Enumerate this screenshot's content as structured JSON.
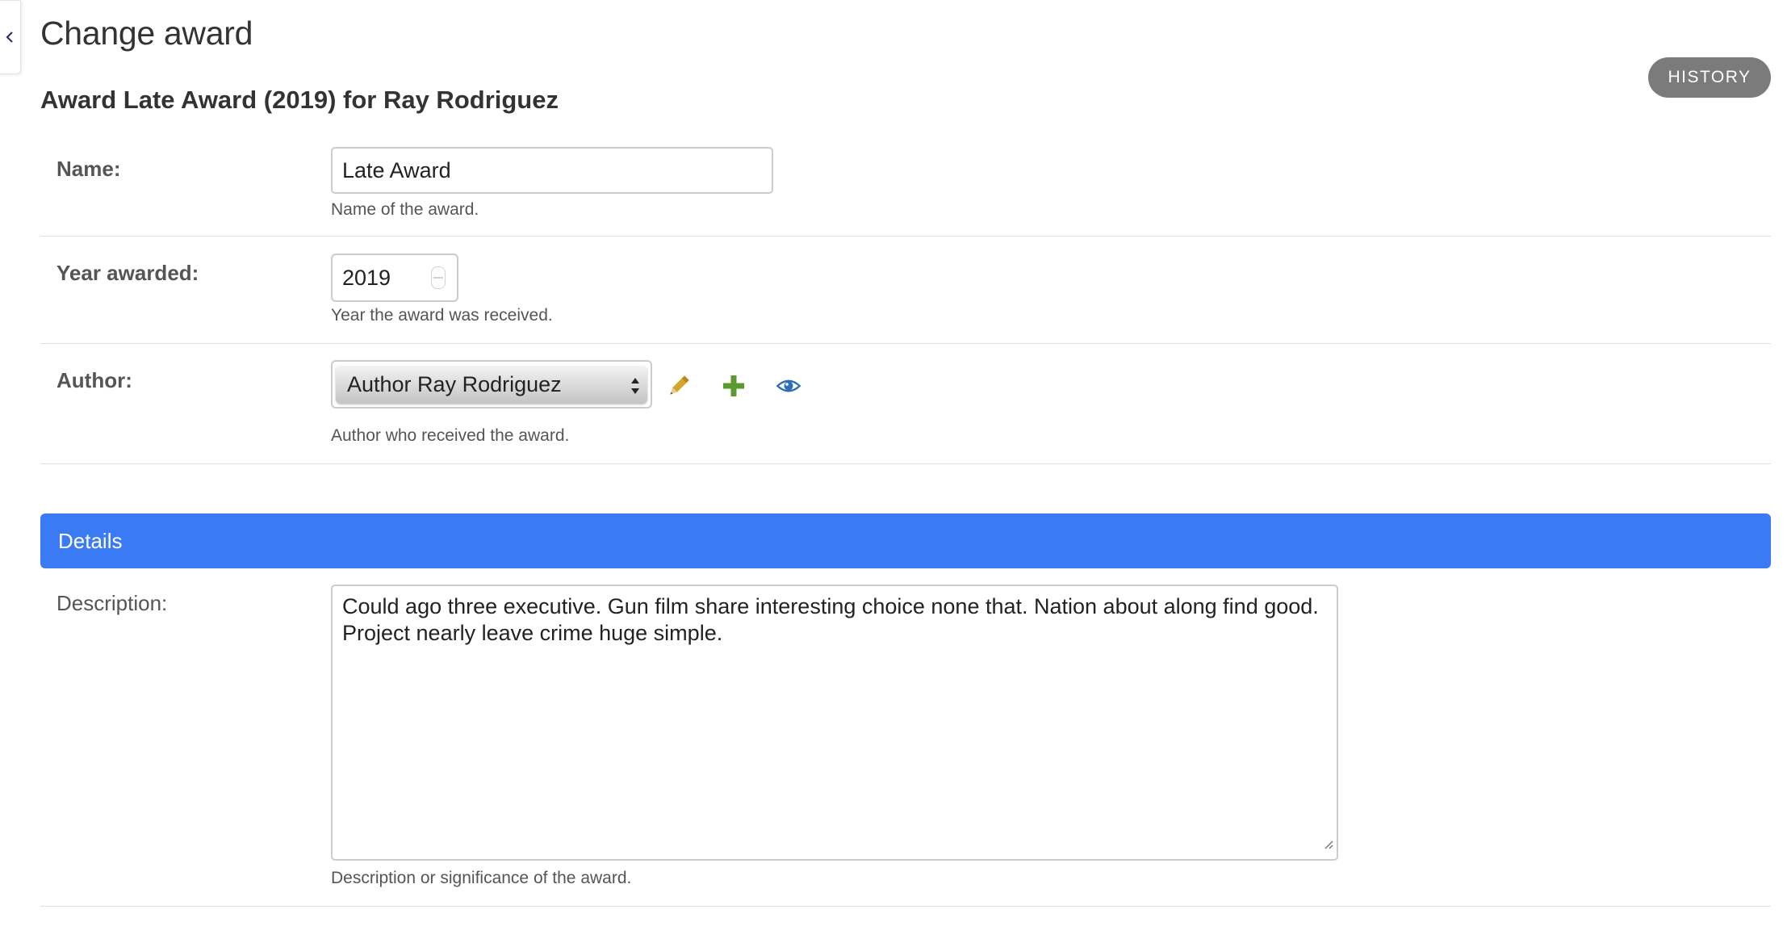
{
  "page": {
    "title": "Change award",
    "object_heading": "Award Late Award (2019) for Ray Rodriguez",
    "history_label": "HISTORY"
  },
  "fields": {
    "name": {
      "label": "Name:",
      "value": "Late Award",
      "help": "Name of the award."
    },
    "year": {
      "label": "Year awarded:",
      "value": "2019",
      "help": "Year the award was received."
    },
    "author": {
      "label": "Author:",
      "selected": "Author Ray Rodriguez",
      "help": "Author who received the award.",
      "actions": [
        "pencil-icon",
        "plus-icon",
        "eye-icon"
      ]
    }
  },
  "details": {
    "title": "Details",
    "description": {
      "label": "Description:",
      "value": "Could ago three executive. Gun film share interesting choice none that. Nation about along find good. Project nearly leave crime huge simple.",
      "help": "Description or significance of the award."
    }
  },
  "colors": {
    "accent": "#3a7bf5",
    "history_button": "#7b7b7b",
    "edit_icon": "#c9a227",
    "add_icon": "#5a9a2e",
    "view_icon": "#2f6db5"
  }
}
